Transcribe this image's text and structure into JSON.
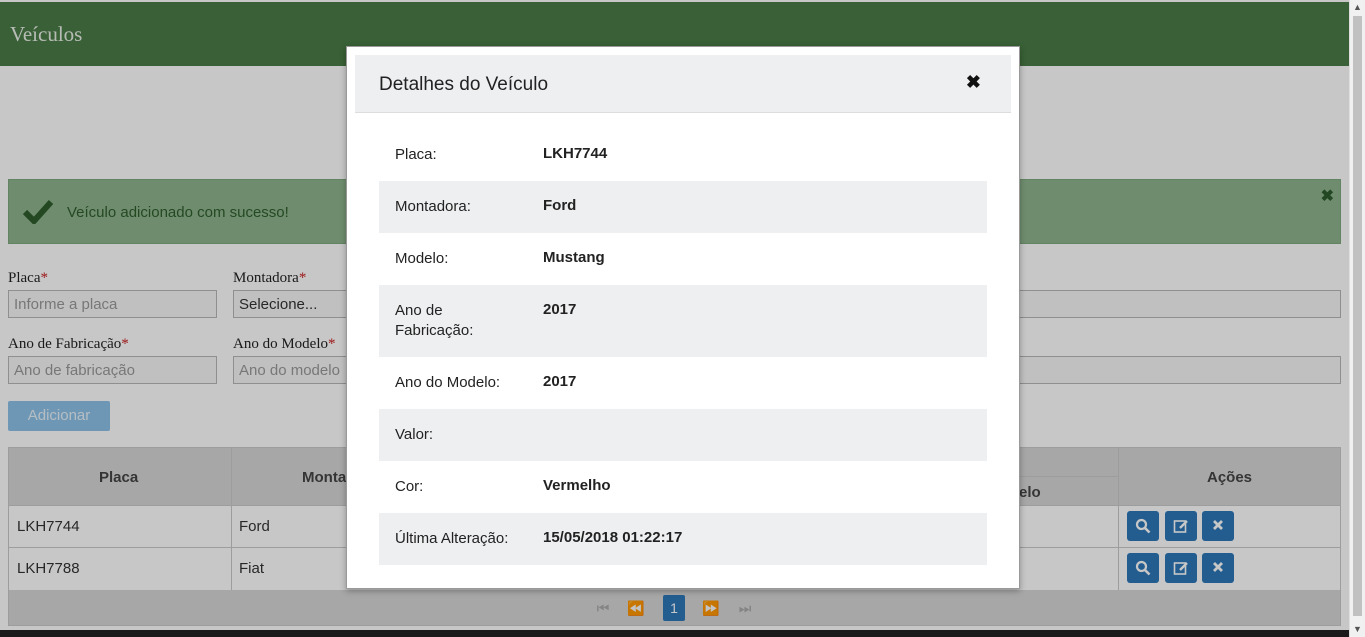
{
  "header": {
    "title": "Veículos"
  },
  "alert": {
    "message": "Veículo adicionado com sucesso!",
    "close": "✖"
  },
  "form": {
    "placa_label": "Placa",
    "placa_placeholder": "Informe a placa",
    "montadora_label": "Montadora",
    "montadora_value": "Selecione...",
    "ano_fab_label": "Ano de Fabricação",
    "ano_fab_placeholder": "Ano de fabricação",
    "ano_mod_label": "Ano do Modelo",
    "ano_mod_placeholder": "Ano do modelo",
    "required_mark": "*",
    "add_button": "Adicionar"
  },
  "table": {
    "headers": {
      "placa": "Placa",
      "montadora": "Monta",
      "modelo_partial": "elo",
      "acoes": "Ações"
    },
    "rows": [
      {
        "placa": "LKH7744",
        "montadora": "Ford"
      },
      {
        "placa": "LKH7788",
        "montadora": "Fiat"
      }
    ],
    "pagination": {
      "current": "1"
    }
  },
  "modal": {
    "title": "Detalhes do Veículo",
    "close": "✖",
    "fields": [
      {
        "label": "Placa:",
        "value": "LKH7744"
      },
      {
        "label": "Montadora:",
        "value": "Ford"
      },
      {
        "label": "Modelo:",
        "value": "Mustang"
      },
      {
        "label": "Ano de\nFabricação:",
        "value": "2017"
      },
      {
        "label": "Ano do Modelo:",
        "value": "2017"
      },
      {
        "label": "Valor:",
        "value": ""
      },
      {
        "label": "Cor:",
        "value": "Vermelho"
      },
      {
        "label": "Última Alteração:",
        "value": "15/05/2018 01:22:17"
      }
    ]
  },
  "colors": {
    "header": "#4a7c46",
    "alert": "#8fb58e",
    "action": "#2e78b8"
  }
}
